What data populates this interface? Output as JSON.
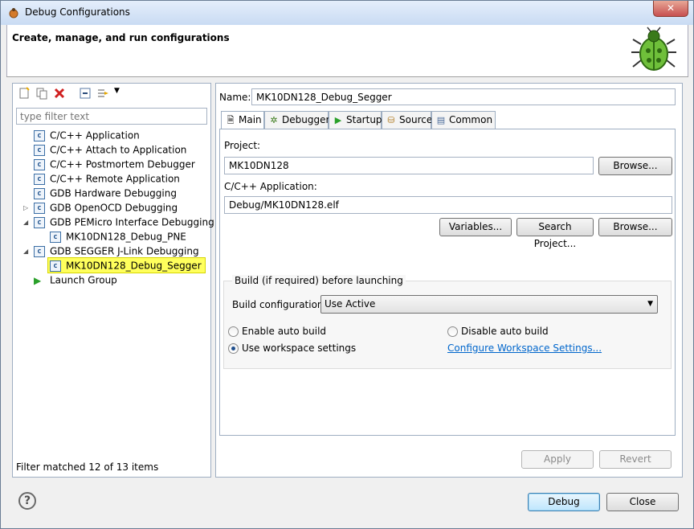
{
  "window": {
    "title": "Debug Configurations",
    "close_label": "✕"
  },
  "header": {
    "title": "Create, manage, and run configurations"
  },
  "left": {
    "filter_placeholder": "type filter text",
    "tree": [
      {
        "label": "C/C++ Application",
        "icon": "c-icon"
      },
      {
        "label": "C/C++ Attach to Application",
        "icon": "c-icon"
      },
      {
        "label": "C/C++ Postmortem Debugger",
        "icon": "c-icon"
      },
      {
        "label": "C/C++ Remote Application",
        "icon": "c-icon"
      },
      {
        "label": "GDB Hardware Debugging",
        "icon": "c-icon"
      },
      {
        "label": "GDB OpenOCD Debugging",
        "icon": "c-icon"
      },
      {
        "label": "GDB PEMicro Interface Debugging",
        "icon": "c-icon"
      },
      {
        "label": "MK10DN128_Debug_PNE",
        "icon": "c-icon"
      },
      {
        "label": "GDB SEGGER J-Link Debugging",
        "icon": "c-icon"
      },
      {
        "label": "MK10DN128_Debug_Segger",
        "icon": "c-icon"
      },
      {
        "label": "Launch Group",
        "icon": "launch-icon"
      }
    ],
    "status": "Filter matched 12 of 13 items"
  },
  "right": {
    "name_label": "Name:",
    "name_value": "MK10DN128_Debug_Segger",
    "tabs": [
      {
        "label": "Main"
      },
      {
        "label": "Debugger"
      },
      {
        "label": "Startup"
      },
      {
        "label": "Source"
      },
      {
        "label": "Common"
      }
    ],
    "main": {
      "project_label": "Project:",
      "project_value": "MK10DN128",
      "browse_label": "Browse...",
      "app_label": "C/C++ Application:",
      "app_value": "Debug/MK10DN128.elf",
      "variables_label": "Variables...",
      "search_project_label": "Search Project...",
      "build_group_title": "Build (if required) before launching",
      "build_config_label": "Build configuration:",
      "build_config_value": "Use Active",
      "enable_auto_build": "Enable auto build",
      "disable_auto_build": "Disable auto build",
      "use_workspace": "Use workspace settings",
      "configure_link": "Configure Workspace Settings..."
    },
    "apply_label": "Apply",
    "revert_label": "Revert"
  },
  "footer": {
    "help_label": "?",
    "debug_label": "Debug",
    "close_label": "Close"
  },
  "colors": {
    "selection": "#ffff5c",
    "link": "#0066cc"
  }
}
